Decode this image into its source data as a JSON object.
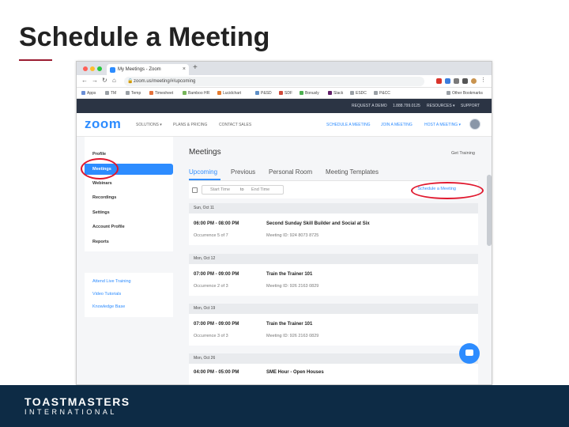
{
  "slide": {
    "title": "Schedule a Meeting"
  },
  "browser": {
    "tab_title": "My Meetings - Zoom",
    "tab_close": "×",
    "new_tab": "+",
    "nav": {
      "back": "←",
      "forward": "→",
      "reload": "↻",
      "home": "⌂"
    },
    "url": "zoom.us/meeting/#/upcoming",
    "lock": "🔒",
    "bookmarks": [
      "Apps",
      "TM",
      "Temp",
      "Timesheet",
      "Bamboo HR",
      "Lucidchart",
      "P&SD",
      "SDF",
      "Bonusly",
      "Slack",
      "ESDC",
      "P&CC"
    ],
    "other_bookmarks": "Other Bookmarks"
  },
  "zoom_top": {
    "links": [
      "REQUEST A DEMO",
      "1.888.799.0125",
      "RESOURCES ▾",
      "SUPPORT"
    ]
  },
  "zoom_nav": {
    "logo": "zoom",
    "left": [
      "SOLUTIONS ▾",
      "PLANS & PRICING",
      "CONTACT SALES"
    ],
    "right": [
      "SCHEDULE A MEETING",
      "JOIN A MEETING",
      "HOST A MEETING ▾"
    ]
  },
  "sidebar": {
    "items": [
      "Profile",
      "Meetings",
      "Webinars",
      "Recordings",
      "Settings",
      "Account Profile",
      "Reports"
    ],
    "help": [
      "Attend Live Training",
      "Video Tutorials",
      "Knowledge Base"
    ]
  },
  "main": {
    "title": "Meetings",
    "get_training": "Get Training",
    "tabs": [
      "Upcoming",
      "Previous",
      "Personal Room",
      "Meeting Templates"
    ],
    "filter": {
      "start": "Start Time",
      "to": "to",
      "end": "End Time"
    },
    "schedule_link": "Schedule a Meeting",
    "days": [
      {
        "label": "Sun, Oct 11",
        "meeting": {
          "time": "06:00 PM - 08:00 PM",
          "occurrence": "Occurrence 5 of 7",
          "topic": "Second Sunday Skill Builder and Social at Six",
          "id": "Meeting ID: 924 8073 8725"
        }
      },
      {
        "label": "Mon, Oct 12",
        "meeting": {
          "time": "07:00 PM - 09:00 PM",
          "occurrence": "Occurrence 2 of 3",
          "topic": "Train the Trainer 101",
          "id": "Meeting ID: 926 2163 0829"
        }
      },
      {
        "label": "Mon, Oct 19",
        "meeting": {
          "time": "07:00 PM - 09:00 PM",
          "occurrence": "Occurrence 3 of 3",
          "topic": "Train the Trainer 101",
          "id": "Meeting ID: 926 2163 0829"
        }
      },
      {
        "label": "Mon, Oct 26",
        "meeting": {
          "time": "04:00 PM - 05:00 PM",
          "occurrence": "",
          "topic": "SME Hour - Open Houses",
          "id": ""
        }
      }
    ]
  },
  "footer": {
    "line1": "TOASTMASTERS",
    "line2": "INTERNATIONAL"
  },
  "colors": {
    "zoom_blue": "#2d8cff",
    "highlight_red": "#e0172d",
    "footer_navy": "#0d2b45",
    "accent_rule": "#9b1c31"
  }
}
